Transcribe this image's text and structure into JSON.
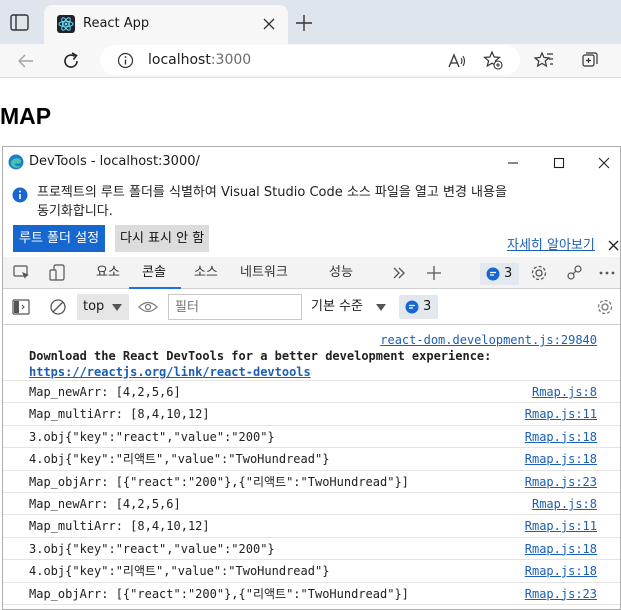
{
  "browser": {
    "tab_title": "React App",
    "url_host": "localhost",
    "url_port": ":3000"
  },
  "page": {
    "heading": "MAP"
  },
  "devtools": {
    "window_title": "DevTools - localhost:3000/",
    "infobar": {
      "message": "프로젝트의 루트 폴더를 식별하여 Visual Studio Code 소스 파일을 열고 변경 내용을 동기화합니다.",
      "learn_more": "자세히 알아보기",
      "set_root_button": "루트 폴더 설정",
      "dont_show_button": "다시 표시 안 함"
    },
    "tabs": [
      "요소",
      "콘솔",
      "소스",
      "네트워크",
      "성능"
    ],
    "active_tab": "콘솔",
    "issues_count": "3",
    "toolbar": {
      "context": "top",
      "filter_placeholder": "필터",
      "level": "기본 수준",
      "issues_count": "3"
    },
    "console": {
      "first_message": {
        "source": "react-dom.development.js:29840",
        "text": "Download the React DevTools for a better development experience: ",
        "link": "https://reactjs.org/link/react-devtools"
      },
      "logs": [
        {
          "text": "Map_newArr: [4,2,5,6]",
          "source": "Rmap.js:8"
        },
        {
          "text": "Map_multiArr: [8,4,10,12]",
          "source": "Rmap.js:11"
        },
        {
          "text": "3.obj{\"key\":\"react\",\"value\":\"200\"}",
          "source": "Rmap.js:18"
        },
        {
          "text": "4.obj{\"key\":\"리액트\",\"value\":\"TwoHundread\"}",
          "source": "Rmap.js:18"
        },
        {
          "text": "Map_objArr: [{\"react\":\"200\"},{\"리액트\":\"TwoHundread\"}]",
          "source": "Rmap.js:23"
        },
        {
          "text": "Map_newArr: [4,2,5,6]",
          "source": "Rmap.js:8"
        },
        {
          "text": "Map_multiArr: [8,4,10,12]",
          "source": "Rmap.js:11"
        },
        {
          "text": "3.obj{\"key\":\"react\",\"value\":\"200\"}",
          "source": "Rmap.js:18"
        },
        {
          "text": "4.obj{\"key\":\"리액트\",\"value\":\"TwoHundread\"}",
          "source": "Rmap.js:18"
        },
        {
          "text": "Map_objArr: [{\"react\":\"200\"},{\"리액트\":\"TwoHundread\"}]",
          "source": "Rmap.js:23"
        }
      ]
    }
  },
  "icons": {
    "tab_favicon": "react-logo-icon",
    "devtools_icon": "edge-logo-icon",
    "issues": "chat-bubble-icon"
  },
  "colors": {
    "accent": "#1668d0",
    "link": "#1a5fb4",
    "react": "#61dafb"
  }
}
